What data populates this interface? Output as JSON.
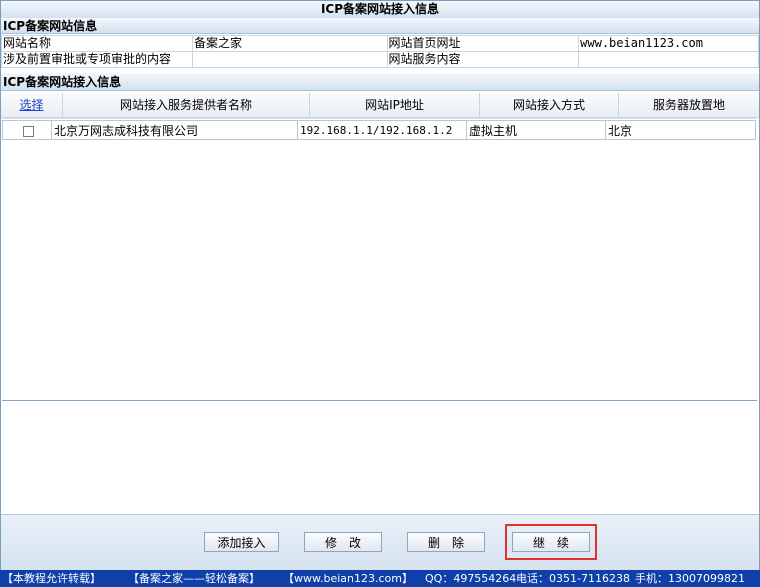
{
  "window_title": "ICP备案网站接入信息",
  "site_info": {
    "section_title": "ICP备案网站信息",
    "name_label": "网站名称",
    "name_value": "备案之家",
    "homepage_label": "网站首页网址",
    "homepage_value": "www.beian1123.com",
    "approval_label": "涉及前置审批或专项审批的内容",
    "approval_value": "",
    "service_label": "网站服务内容",
    "service_value": ""
  },
  "access_info": {
    "section_title": "ICP备案网站接入信息",
    "columns": {
      "select": "选择",
      "provider": "网站接入服务提供者名称",
      "ip": "网站IP地址",
      "method": "网站接入方式",
      "location": "服务器放置地"
    },
    "rows": [
      {
        "checked": false,
        "provider": "北京万网志成科技有限公司",
        "ip": "192.168.1.1/192.168.1.2",
        "method": "虚拟主机",
        "location": "北京"
      }
    ]
  },
  "buttons": {
    "add": "添加接入",
    "edit": "修　改",
    "delete": "删　除",
    "continue": "继　续"
  },
  "footer": {
    "notice": "【本教程允许转载】",
    "brand": "【备案之家——轻松备案】",
    "website": "【www.beian123.com】",
    "qq": "QQ：497554264",
    "phone": "电话：0351-7116238",
    "mobile": "手机：13007099821"
  },
  "colors": {
    "accent_border": "#e03030",
    "footer_bg": "#0f3fa8"
  }
}
